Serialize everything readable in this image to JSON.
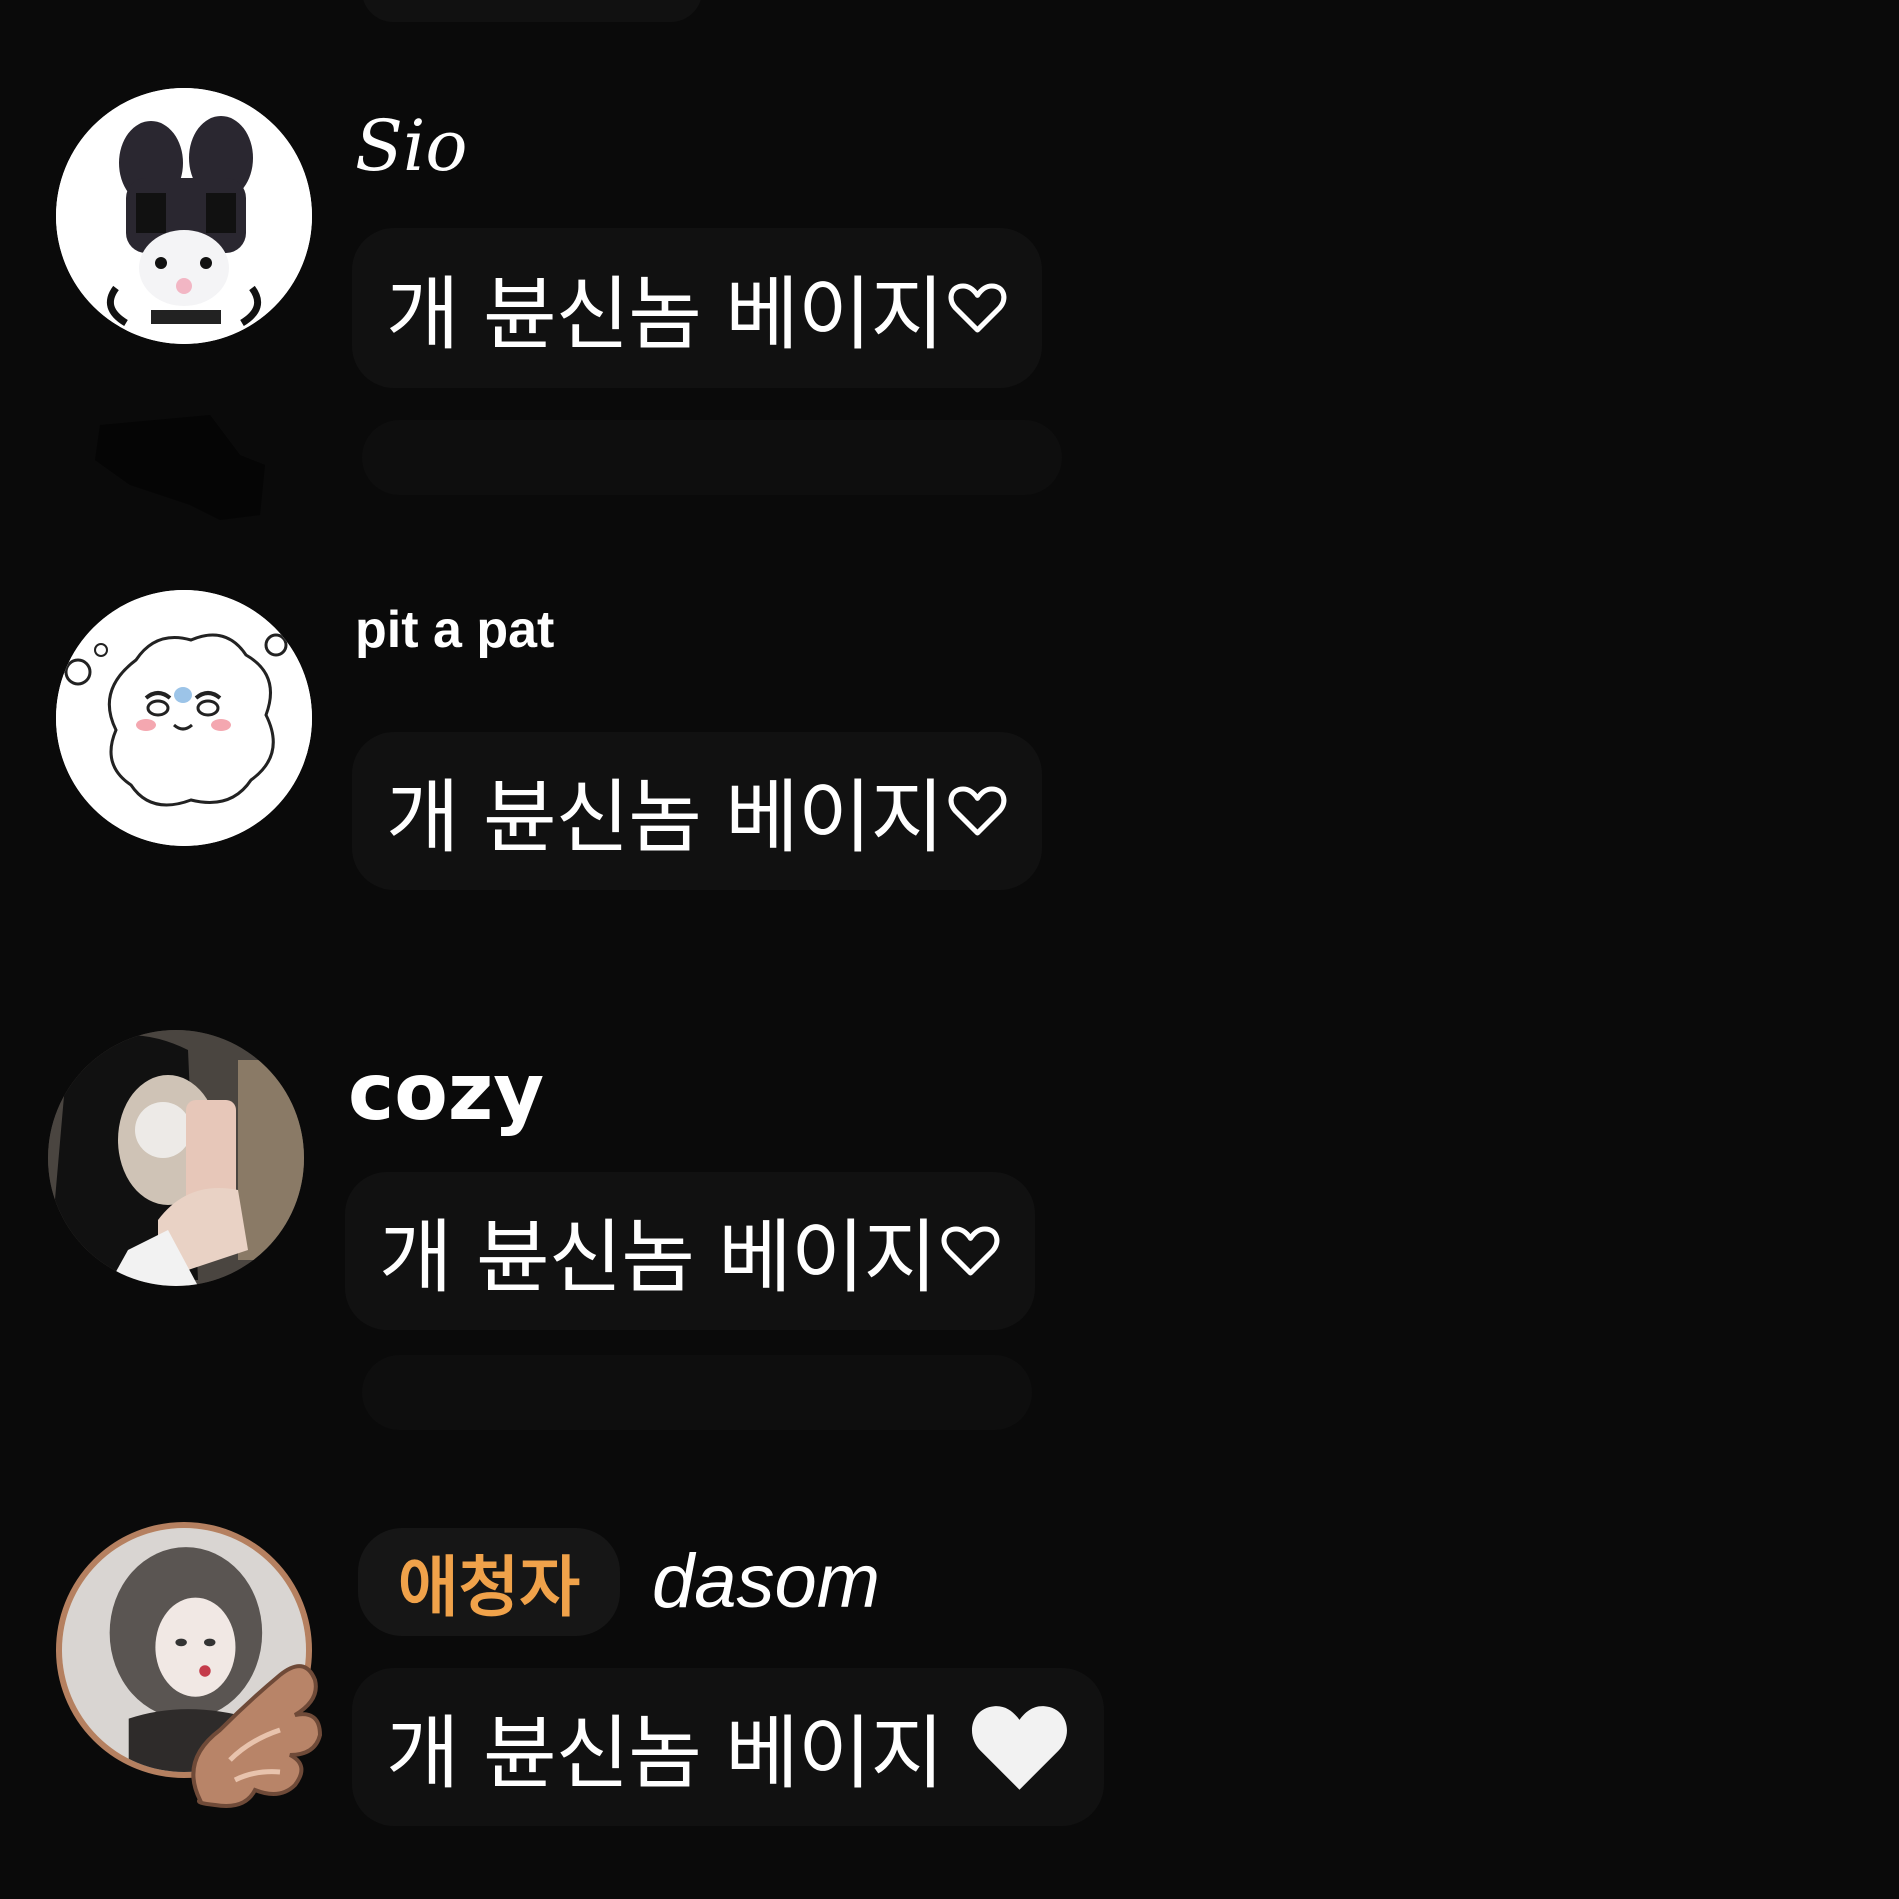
{
  "comments": [
    {
      "username": "Sio",
      "message": "개 뷴신놈 베이지",
      "emoji": "heart-outline-icon",
      "avatar": "bunny-avatar"
    },
    {
      "username": "pit a pat",
      "message": "개 뷴신놈 베이지",
      "emoji": "heart-outline-icon",
      "avatar": "sheep-avatar"
    },
    {
      "username": "cozy",
      "message": "개 뷴신놈 베이지",
      "emoji": "heart-outline-icon",
      "avatar": "selfie-avatar"
    },
    {
      "badge": "애청자",
      "username": "dasom",
      "message": "개 뷴신놈 베이지",
      "emoji": "white-heart-icon",
      "avatar": "illustration-avatar"
    }
  ],
  "colors": {
    "background": "#0a0a0a",
    "bubble": "#111111",
    "badge_text": "#f0a24a",
    "text": "#ffffff"
  }
}
